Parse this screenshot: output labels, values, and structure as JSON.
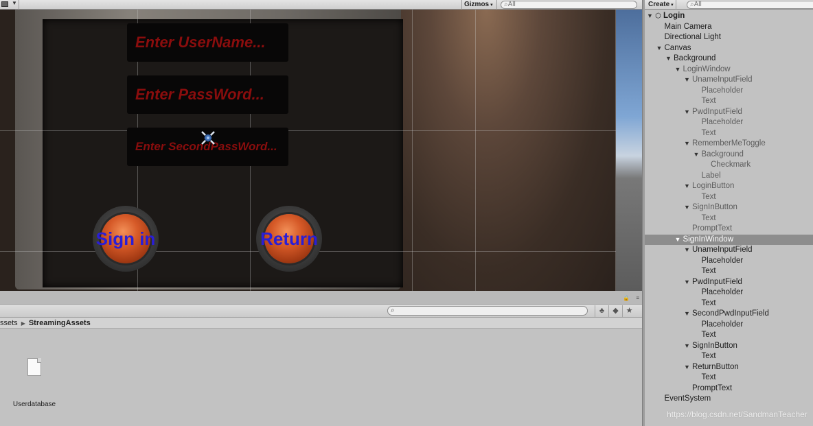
{
  "scene": {
    "gizmos_label": "Gizmos",
    "search_placeholder": "All",
    "username_placeholder": "Enter UserName...",
    "password_placeholder": "Enter PassWord...",
    "second_password_placeholder": "Enter SecondPassWord...",
    "signin_label": "Sign in",
    "return_label": "Return"
  },
  "project": {
    "breadcrumb": [
      "ssets",
      "StreamingAssets"
    ],
    "files": [
      {
        "name": "Userdatabase",
        "icon": "file-icon"
      }
    ]
  },
  "hierarchy": {
    "create_label": "Create",
    "search_placeholder": "All",
    "scene_name": "Login",
    "items": [
      {
        "label": "Main Camera",
        "depth": 1,
        "expanded": null,
        "selected": false
      },
      {
        "label": "Directional Light",
        "depth": 1,
        "expanded": null,
        "selected": false
      },
      {
        "label": "Canvas",
        "depth": 1,
        "expanded": true,
        "selected": false
      },
      {
        "label": "Background",
        "depth": 2,
        "expanded": true,
        "selected": false
      },
      {
        "label": "LoginWindow",
        "depth": 3,
        "expanded": true,
        "selected": false,
        "dim": true
      },
      {
        "label": "UnameInputField",
        "depth": 4,
        "expanded": true,
        "selected": false,
        "dim": true
      },
      {
        "label": "Placeholder",
        "depth": 5,
        "expanded": null,
        "selected": false,
        "dim": true
      },
      {
        "label": "Text",
        "depth": 5,
        "expanded": null,
        "selected": false,
        "dim": true
      },
      {
        "label": "PwdInputField",
        "depth": 4,
        "expanded": true,
        "selected": false,
        "dim": true
      },
      {
        "label": "Placeholder",
        "depth": 5,
        "expanded": null,
        "selected": false,
        "dim": true
      },
      {
        "label": "Text",
        "depth": 5,
        "expanded": null,
        "selected": false,
        "dim": true
      },
      {
        "label": "RememberMeToggle",
        "depth": 4,
        "expanded": true,
        "selected": false,
        "dim": true
      },
      {
        "label": "Background",
        "depth": 5,
        "expanded": true,
        "selected": false,
        "dim": true
      },
      {
        "label": "Checkmark",
        "depth": 6,
        "expanded": null,
        "selected": false,
        "dim": true
      },
      {
        "label": "Label",
        "depth": 5,
        "expanded": null,
        "selected": false,
        "dim": true
      },
      {
        "label": "LoginButton",
        "depth": 4,
        "expanded": true,
        "selected": false,
        "dim": true
      },
      {
        "label": "Text",
        "depth": 5,
        "expanded": null,
        "selected": false,
        "dim": true
      },
      {
        "label": "SignInButton",
        "depth": 4,
        "expanded": true,
        "selected": false,
        "dim": true
      },
      {
        "label": "Text",
        "depth": 5,
        "expanded": null,
        "selected": false,
        "dim": true
      },
      {
        "label": "PromptText",
        "depth": 4,
        "expanded": null,
        "selected": false,
        "dim": true
      },
      {
        "label": "SignInWindow",
        "depth": 3,
        "expanded": true,
        "selected": true
      },
      {
        "label": "UnameInputField",
        "depth": 4,
        "expanded": true,
        "selected": false
      },
      {
        "label": "Placeholder",
        "depth": 5,
        "expanded": null,
        "selected": false
      },
      {
        "label": "Text",
        "depth": 5,
        "expanded": null,
        "selected": false
      },
      {
        "label": "PwdInputField",
        "depth": 4,
        "expanded": true,
        "selected": false
      },
      {
        "label": "Placeholder",
        "depth": 5,
        "expanded": null,
        "selected": false
      },
      {
        "label": "Text",
        "depth": 5,
        "expanded": null,
        "selected": false
      },
      {
        "label": "SecondPwdInputField",
        "depth": 4,
        "expanded": true,
        "selected": false
      },
      {
        "label": "Placeholder",
        "depth": 5,
        "expanded": null,
        "selected": false
      },
      {
        "label": "Text",
        "depth": 5,
        "expanded": null,
        "selected": false
      },
      {
        "label": "SignInButton",
        "depth": 4,
        "expanded": true,
        "selected": false
      },
      {
        "label": "Text",
        "depth": 5,
        "expanded": null,
        "selected": false
      },
      {
        "label": "ReturnButton",
        "depth": 4,
        "expanded": true,
        "selected": false
      },
      {
        "label": "Text",
        "depth": 5,
        "expanded": null,
        "selected": false
      },
      {
        "label": "PromptText",
        "depth": 4,
        "expanded": null,
        "selected": false
      },
      {
        "label": "EventSystem",
        "depth": 1,
        "expanded": null,
        "selected": false
      }
    ]
  },
  "watermark": "https://blog.csdn.net/SandmanTeacher",
  "colors": {
    "placeholder_text": "#8a0d0d",
    "button_text": "#2a1ed6",
    "selection": "#8d8d8d"
  }
}
